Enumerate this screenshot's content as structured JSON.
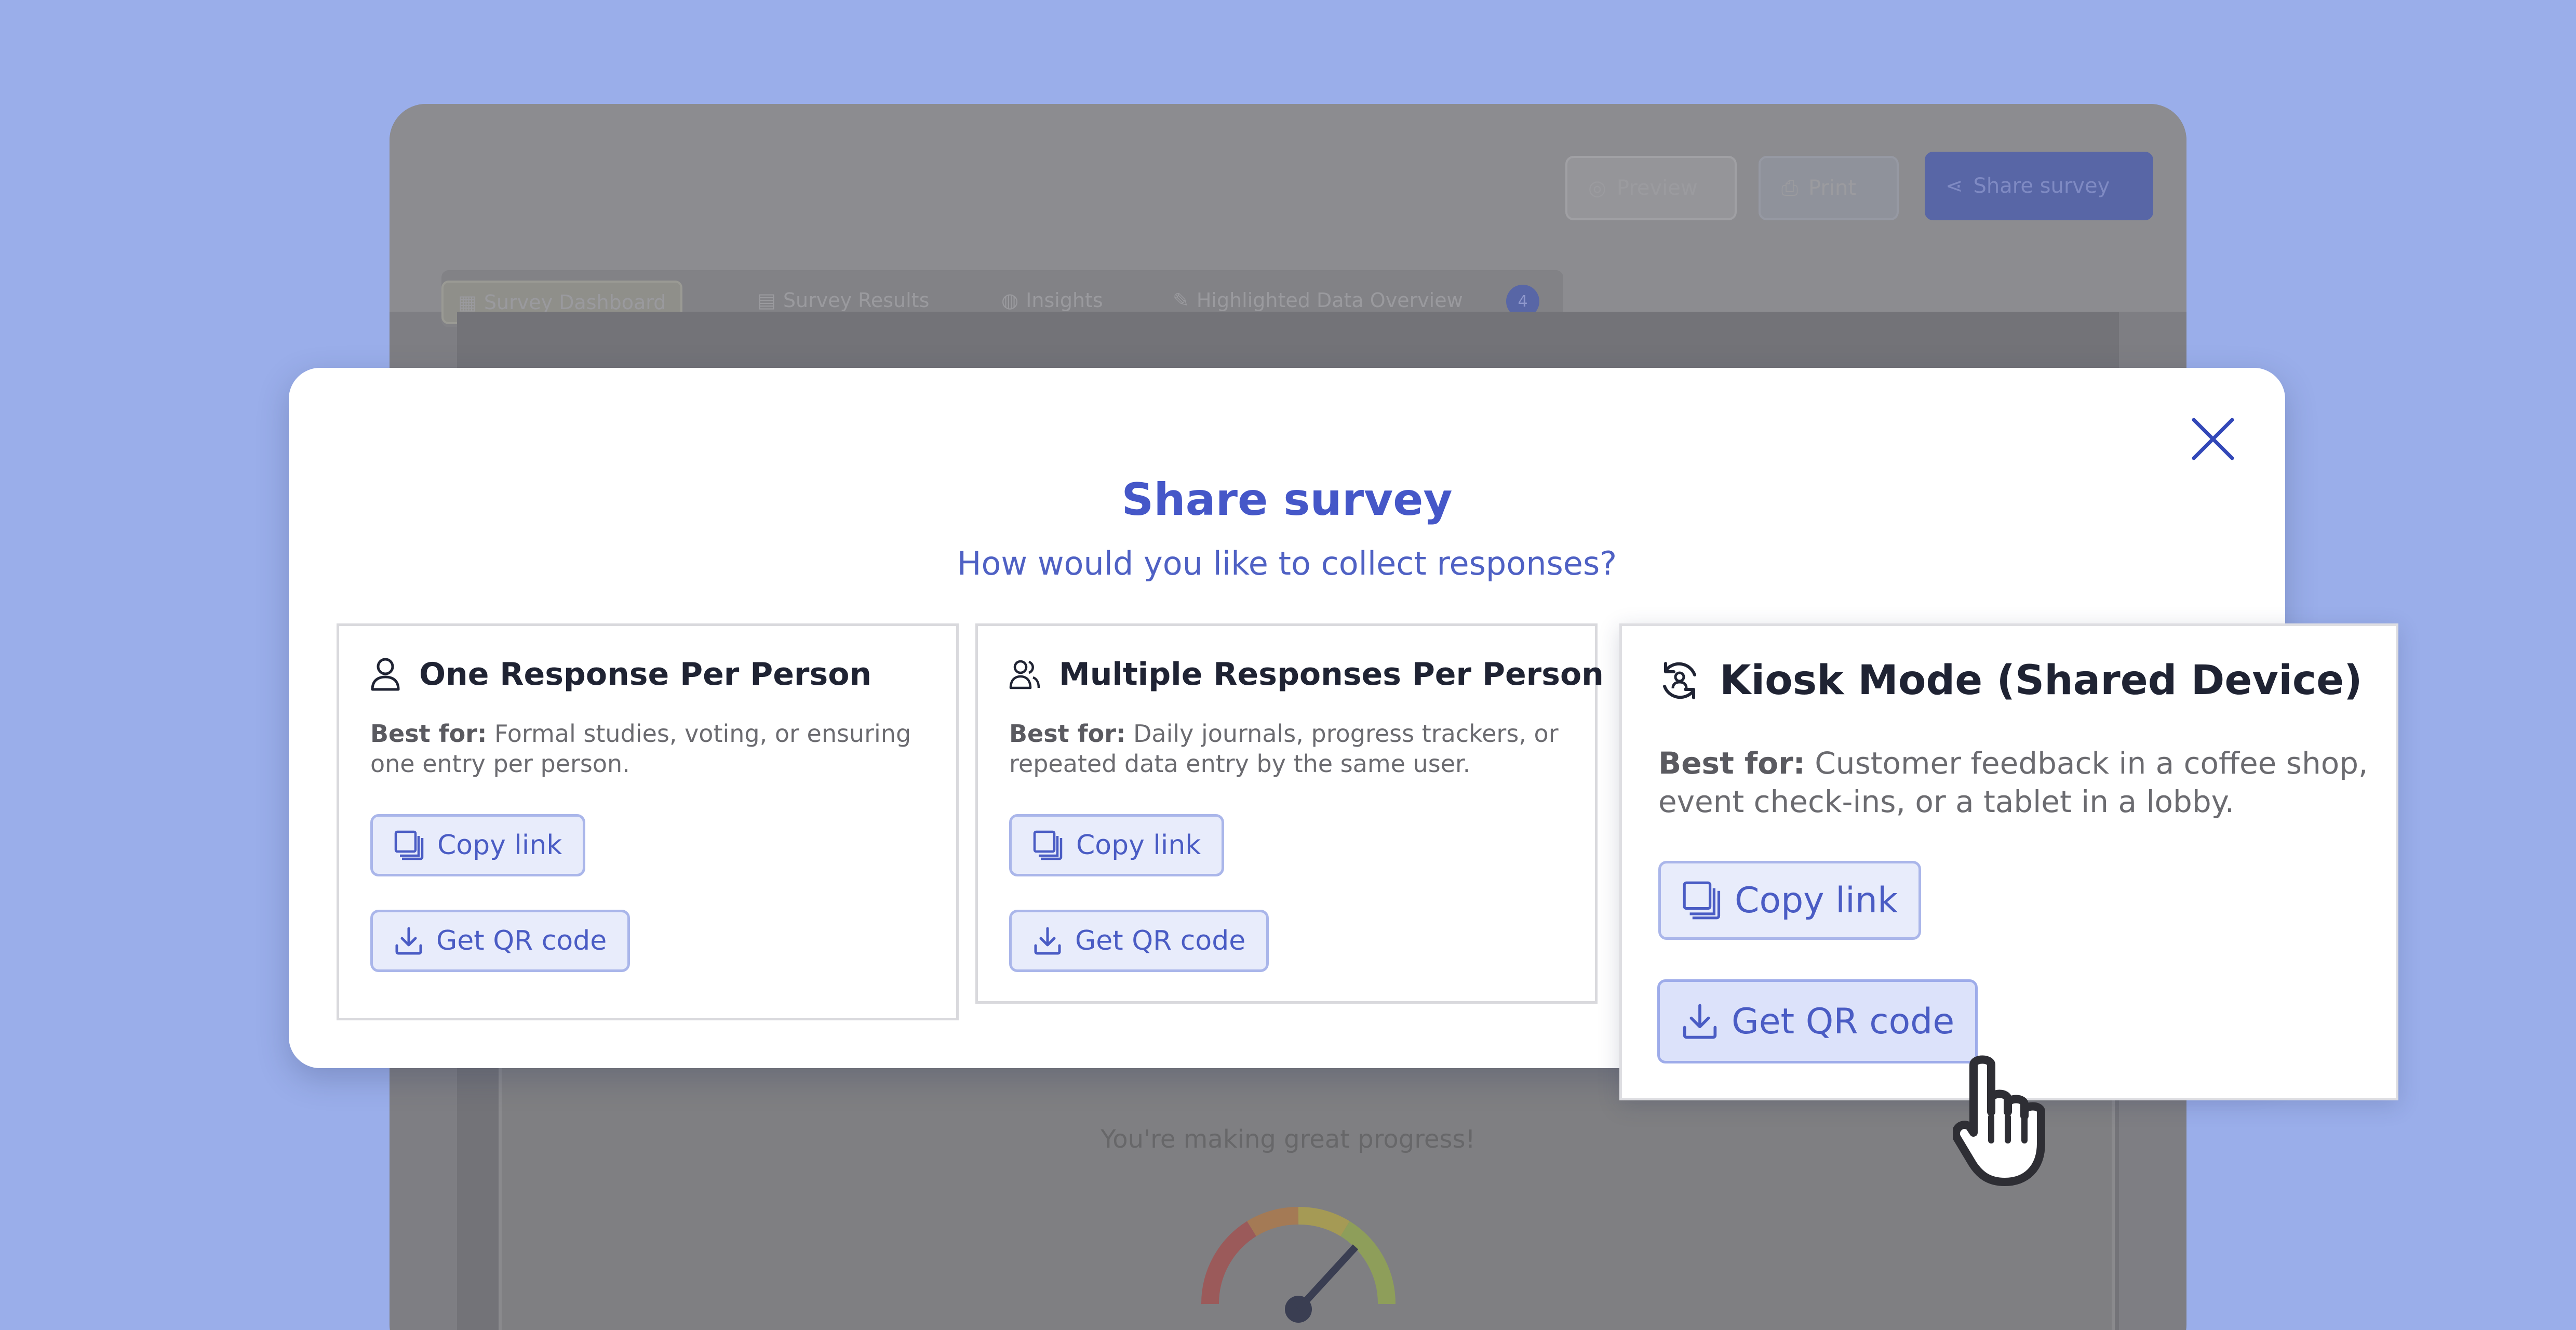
{
  "background_app": {
    "preview_label": "Preview",
    "print_label": "Print",
    "share_label": "Share survey",
    "tabs": [
      "Survey Dashboard",
      "Survey Results",
      "Insights",
      "Highlighted Data Overview"
    ],
    "badge_count": "4",
    "progress_text": "You're making great progress!"
  },
  "modal": {
    "title": "Share survey",
    "subtitle": "How would you like to collect responses?",
    "options": [
      {
        "title": "One Response Per Person",
        "icon": "person-icon",
        "best_for_label": "Best for:",
        "best_for_text": " Formal studies, voting, or ensuring one entry per person.",
        "copy_label": "Copy link",
        "qr_label": "Get QR code"
      },
      {
        "title": "Multiple Responses Per Person",
        "icon": "people-icon",
        "best_for_label": "Best for:",
        "best_for_text": " Daily journals, progress trackers, or repeated data entry by the same user.",
        "copy_label": "Copy link",
        "qr_label": "Get QR code"
      },
      {
        "title": "Kiosk Mode (Shared Device)",
        "icon": "refresh-person-icon",
        "best_for_label": "Best for:",
        "best_for_text": " Customer feedback in a coffee shop, event check-ins, or a tablet in a lobby.",
        "copy_label": "Copy link",
        "qr_label": "Get QR code"
      }
    ]
  },
  "colors": {
    "page_background": "#9aaeea",
    "accent": "#4557c8",
    "button_fill": "#e8ecfb",
    "button_border": "#aab6ea"
  }
}
